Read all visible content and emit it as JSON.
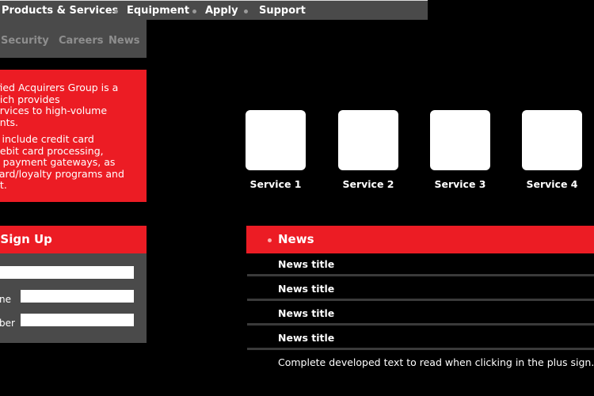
{
  "top_nav": {
    "items": [
      "Products & Services",
      "Equipment",
      "Apply",
      "Support"
    ]
  },
  "sub_nav": {
    "items": [
      "Security",
      "Careers",
      "News"
    ]
  },
  "about": {
    "paragraph1": "ified Acquirers Group is a\nhich provides\nervices to high-volume\nents.",
    "paragraph2": "s include credit card\ndebit card processing,\ne payment gateways, as\ncard/loyalty programs and\nnt."
  },
  "signup": {
    "title": "t Sign Up",
    "fields": [
      {
        "label": "",
        "value": ""
      },
      {
        "label": "ne",
        "value": ""
      },
      {
        "label": "ber",
        "value": ""
      }
    ]
  },
  "services": [
    {
      "label": "Service 1"
    },
    {
      "label": "Service 2"
    },
    {
      "label": "Service 3"
    },
    {
      "label": "Service 4"
    }
  ],
  "news": {
    "title": "News",
    "items": [
      "News title",
      "News title",
      "News title",
      "News title"
    ],
    "detail": "Complete developed text to read when clicking in the plus sign."
  },
  "colors": {
    "accent": "#ec1c24",
    "panel": "#4a4a4a",
    "background": "#000000"
  }
}
